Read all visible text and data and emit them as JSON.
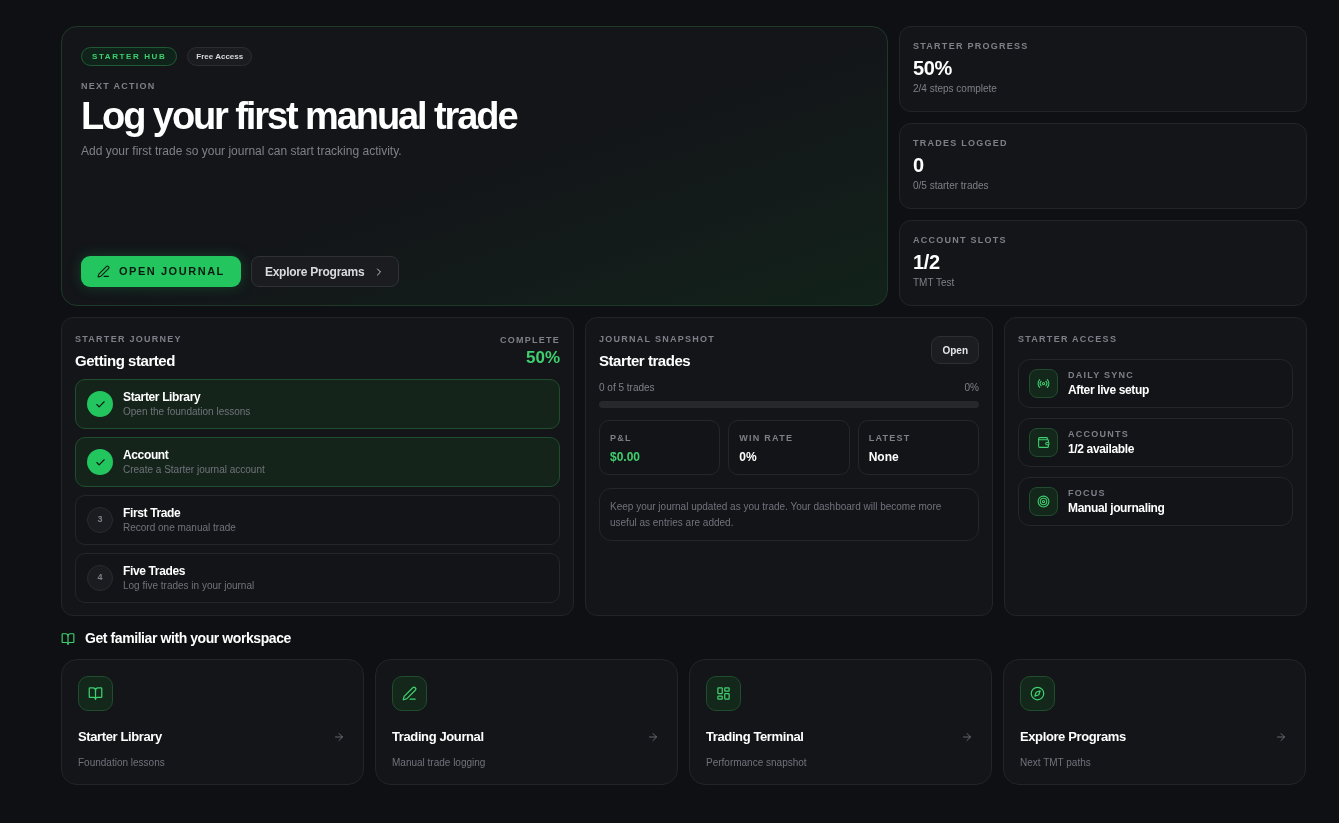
{
  "hero": {
    "badges": [
      {
        "label": "STARTER HUB",
        "kind": "accent"
      },
      {
        "label": "Free Access",
        "kind": "neutral"
      }
    ],
    "eyebrow": "NEXT ACTION",
    "title": "Log your first manual trade",
    "subtitle": "Add your first trade so your journal can start tracking activity.",
    "actions": [
      {
        "label": "OPEN JOURNAL",
        "kind": "primary"
      },
      {
        "label": "Explore Programs",
        "kind": "secondary"
      }
    ]
  },
  "stats": [
    {
      "label": "STARTER PROGRESS",
      "value": "50%",
      "detail": "2/4 steps complete"
    },
    {
      "label": "TRADES LOGGED",
      "value": "0",
      "detail": "0/5 starter trades"
    },
    {
      "label": "ACCOUNT SLOTS",
      "value": "1/2",
      "detail": "TMT Test"
    }
  ],
  "journey": {
    "eyebrow": "STARTER JOURNEY",
    "title": "Getting started",
    "complete_label": "COMPLETE",
    "complete_value": "50%",
    "steps": [
      {
        "title": "Starter Library",
        "description": "Open the foundation lessons",
        "completed": true
      },
      {
        "title": "Account",
        "description": "Create a Starter journal account",
        "completed": true
      },
      {
        "title": "First Trade",
        "description": "Record one manual trade",
        "completed": false,
        "number": "3"
      },
      {
        "title": "Five Trades",
        "description": "Log five trades in your journal",
        "completed": false,
        "number": "4"
      }
    ]
  },
  "snapshot": {
    "eyebrow": "JOURNAL SNAPSHOT",
    "title": "Starter trades",
    "open_button": "Open",
    "progress": {
      "label": "0 of 5 trades",
      "reading": "0%",
      "level": 0
    },
    "metrics": [
      {
        "label": "P&L",
        "value": "$0.00",
        "highlight": true
      },
      {
        "label": "WIN RATE",
        "value": "0%",
        "highlight": false
      },
      {
        "label": "LATEST",
        "value": "None",
        "highlight": false
      }
    ],
    "note": "Keep your journal updated as you trade. Your dashboard will become more useful as entries are added."
  },
  "access": {
    "eyebrow": "STARTER ACCESS",
    "items": [
      {
        "label": "DAILY SYNC",
        "value": "After live setup"
      },
      {
        "label": "ACCOUNTS",
        "value": "1/2 available"
      },
      {
        "label": "FOCUS",
        "value": "Manual journaling"
      }
    ]
  },
  "workspace": {
    "title": "Get familiar with your workspace",
    "cards": [
      {
        "title": "Starter Library",
        "subtitle": "Foundation lessons"
      },
      {
        "title": "Trading Journal",
        "subtitle": "Manual trade logging"
      },
      {
        "title": "Trading Terminal",
        "subtitle": "Performance snapshot"
      },
      {
        "title": "Explore Programs",
        "subtitle": "Next TMT paths"
      }
    ]
  }
}
